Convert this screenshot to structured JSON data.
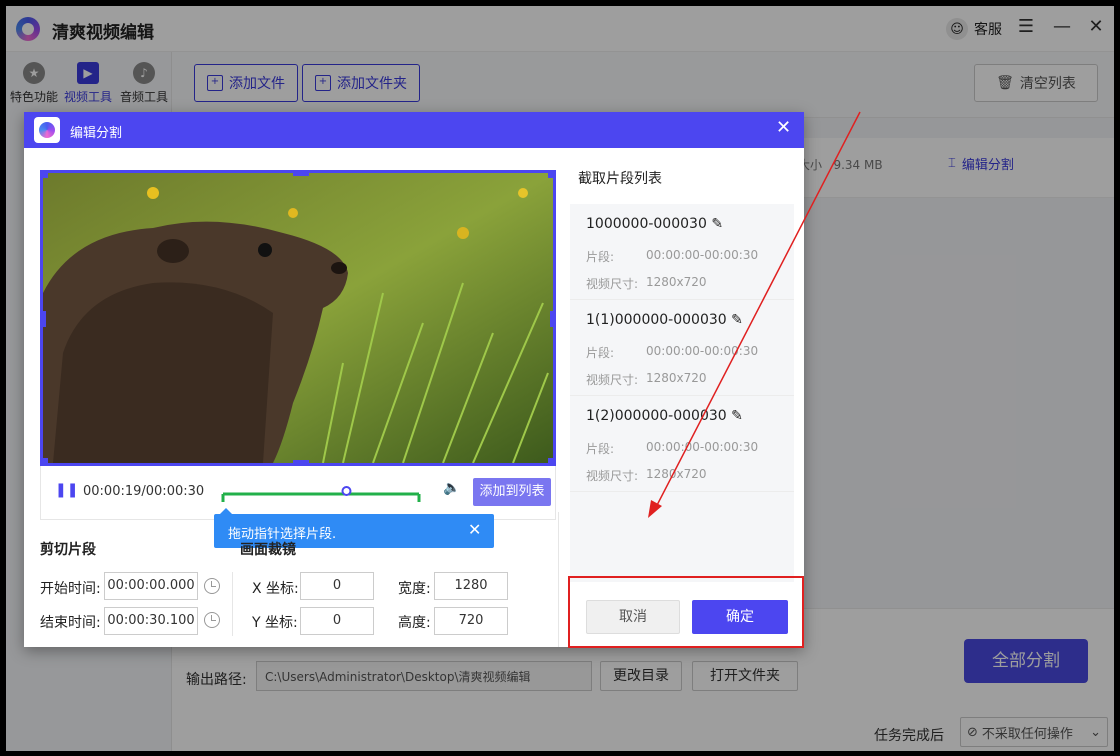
{
  "app": {
    "title": "清爽视频编辑",
    "kefu_label": "客服",
    "menu_icon": "menu-icon",
    "minimize_icon": "minimize-icon",
    "close_icon": "close-icon"
  },
  "nav": [
    {
      "label": "特色功能",
      "icon": "star-icon",
      "active": false
    },
    {
      "label": "视频工具",
      "icon": "film-icon",
      "active": true
    },
    {
      "label": "音频工具",
      "icon": "music-icon",
      "active": false
    }
  ],
  "toolbar": {
    "add_file": "添加文件",
    "add_folder": "添加文件夹",
    "clear_list": "清空列表"
  },
  "file": {
    "size_label": "大小",
    "size_value": "9.34 MB",
    "edit_split": "编辑分割"
  },
  "bottom": {
    "output_label": "输出路径:",
    "output_path": "C:\\Users\\Administrator\\Desktop\\清爽视频编辑",
    "change_dir": "更改目录",
    "open_folder": "打开文件夹",
    "split_all": "全部分割",
    "after_done_label": "任务完成后",
    "after_done_value": "不采取任何操作"
  },
  "dialog": {
    "title": "编辑分割",
    "player": {
      "time": "00:00:19/00:00:30",
      "add_to_list": "添加到列表",
      "progress": 0.63
    },
    "tooltip": "拖动指针选择片段.",
    "cut": {
      "title": "剪切片段",
      "start_label": "开始时间:",
      "start_value": "00:00:00.000",
      "end_label": "结束时间:",
      "end_value": "00:00:30.100"
    },
    "crop": {
      "title": "画面裁镜",
      "x_label": "X 坐标:",
      "x_value": "0",
      "y_label": "Y 坐标:",
      "y_value": "0",
      "w_label": "宽度:",
      "w_value": "1280",
      "h_label": "高度:",
      "h_value": "720"
    },
    "clip_list_title": "截取片段列表",
    "clips": [
      {
        "name": "1000000-000030",
        "seg_label": "片段:",
        "seg_value": "00:00:00-00:00:30",
        "size_label": "视频尺寸:",
        "size_value": "1280x720"
      },
      {
        "name": "1(1)000000-000030",
        "seg_label": "片段:",
        "seg_value": "00:00:00-00:00:30",
        "size_label": "视频尺寸:",
        "size_value": "1280x720"
      },
      {
        "name": "1(2)000000-000030",
        "seg_label": "片段:",
        "seg_value": "00:00:00-00:00:30",
        "size_label": "视频尺寸:",
        "size_value": "1280x720"
      }
    ],
    "cancel": "取消",
    "ok": "确定"
  },
  "colors": {
    "accent": "#4c46f0",
    "annotation": "#e02020",
    "range": "#22b04a"
  }
}
